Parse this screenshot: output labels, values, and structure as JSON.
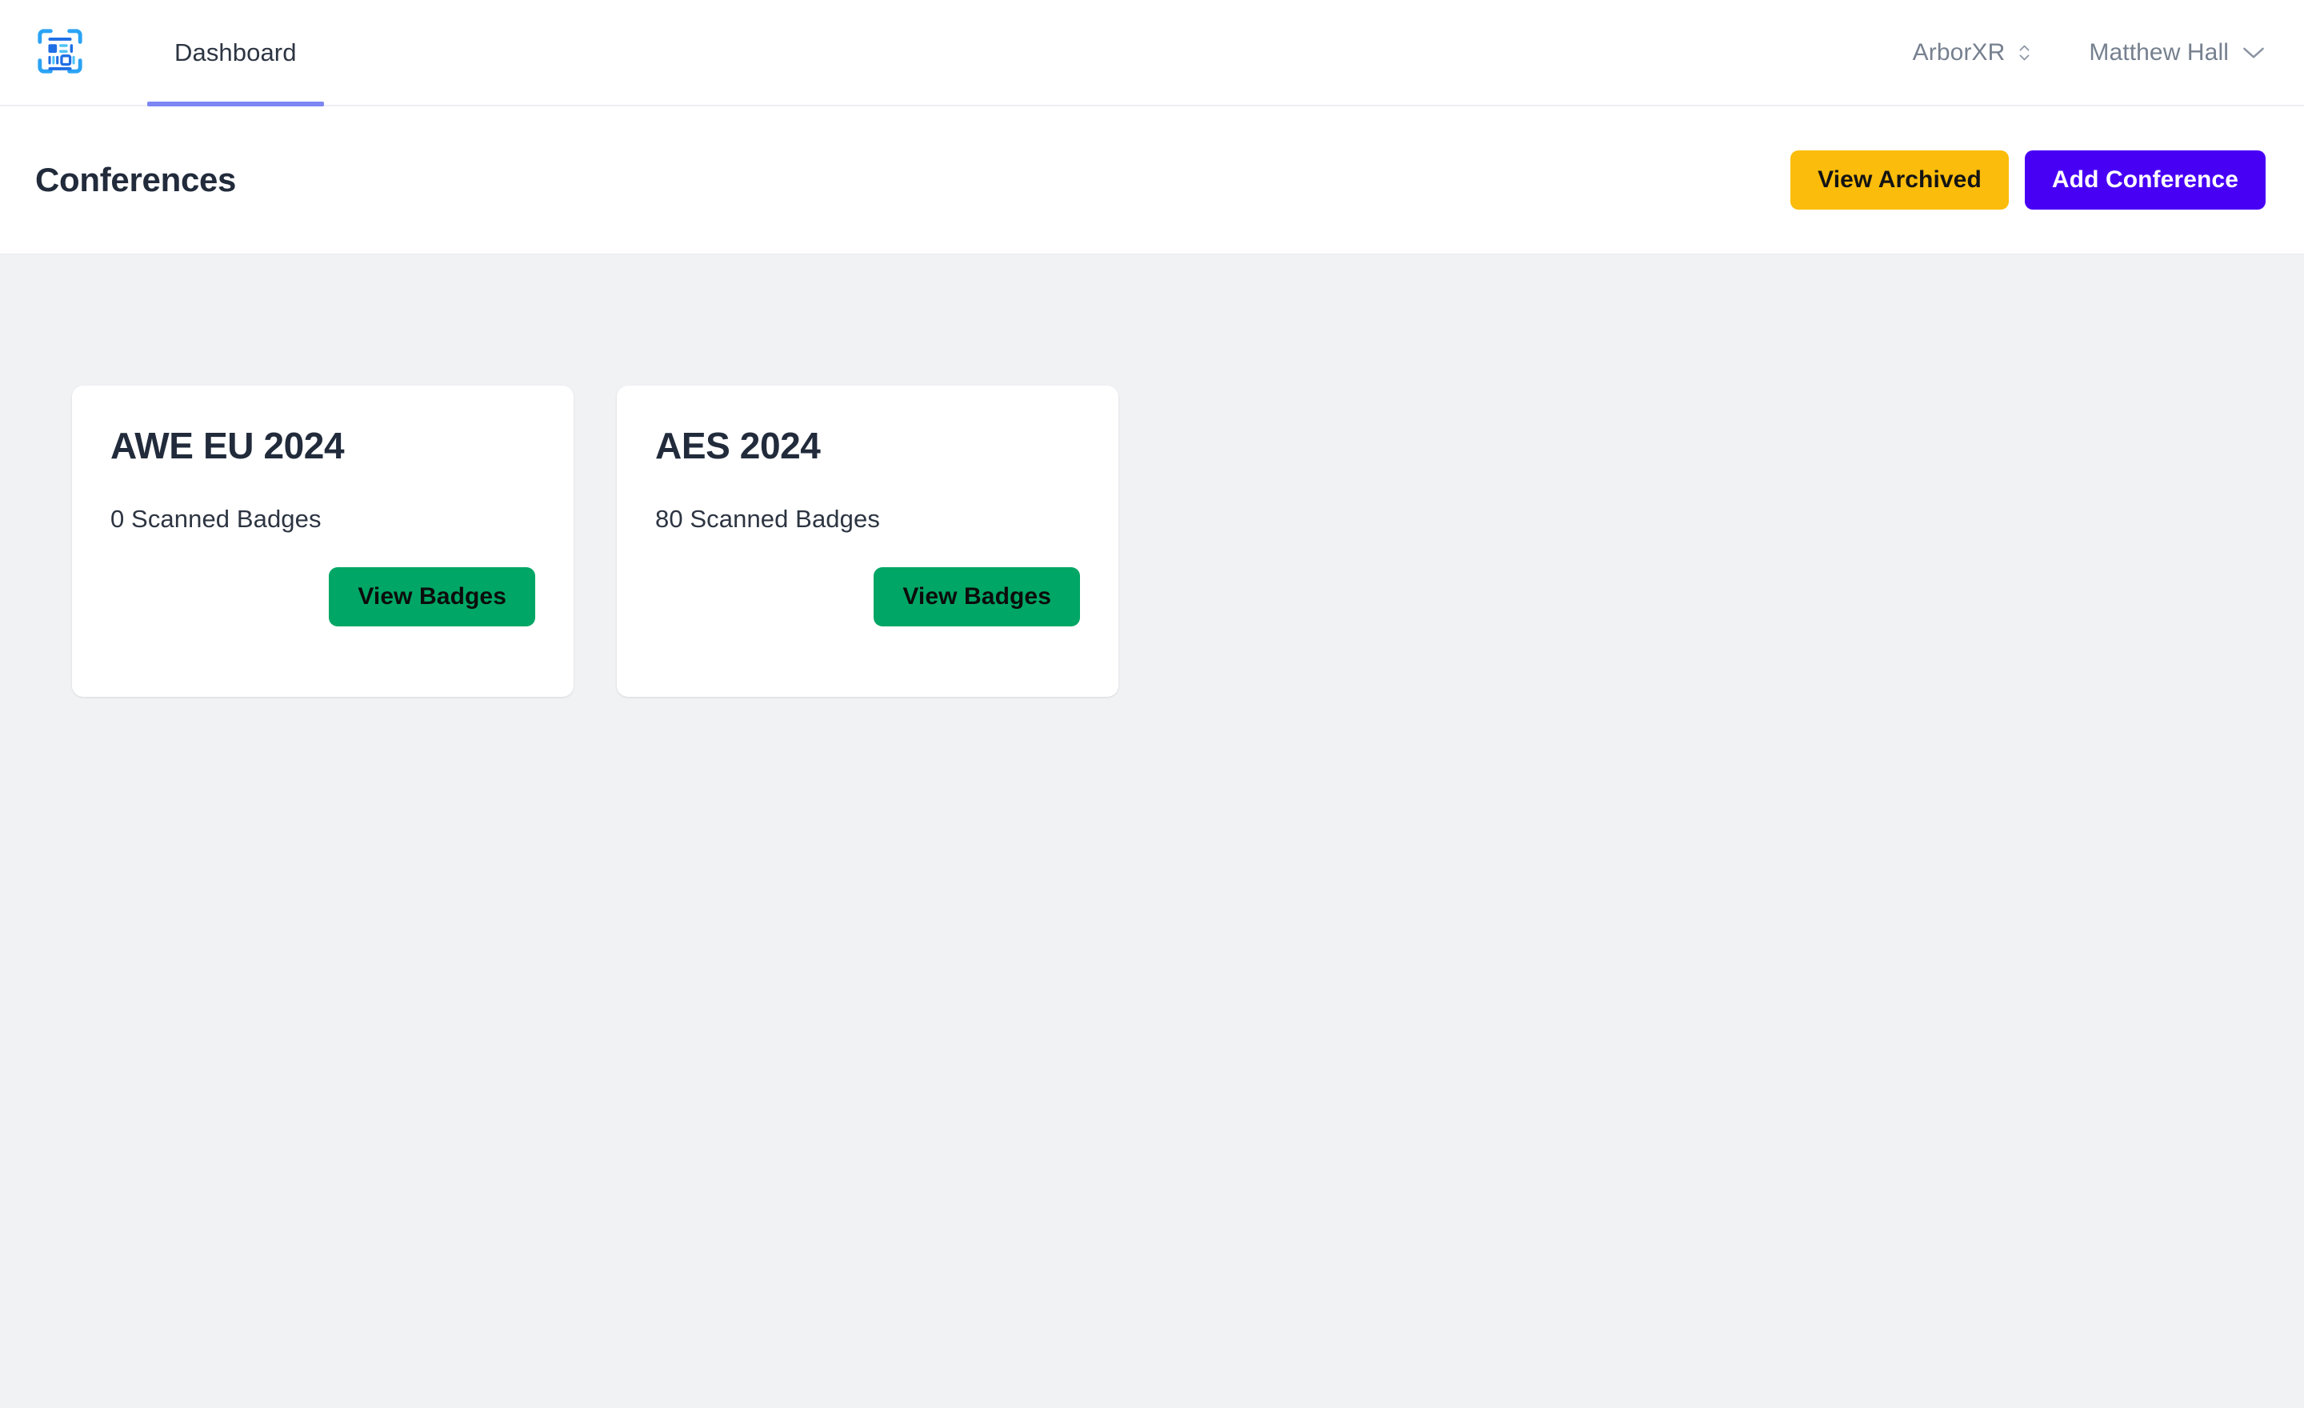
{
  "brand": {
    "logo_icon": "badge-scanner-icon",
    "logo_colors": {
      "bracket": "#2AA3F5",
      "dark_block": "#1F6FE5",
      "light_block": "#4FC3F7"
    }
  },
  "nav": {
    "tabs": [
      {
        "label": "Dashboard",
        "active": true
      }
    ],
    "org_switcher": {
      "label": "ArborXR",
      "icon": "chevron-up-down-icon"
    },
    "user_menu": {
      "label": "Matthew Hall",
      "icon": "chevron-down-icon"
    }
  },
  "page_header": {
    "title": "Conferences",
    "actions": [
      {
        "label": "View Archived",
        "name": "view-archived-button",
        "color": "#FBBC0B",
        "text_color": "#141414"
      },
      {
        "label": "Add Conference",
        "name": "add-conference-button",
        "color": "#4800F5",
        "text_color": "#FFFFFF"
      }
    ]
  },
  "conferences": [
    {
      "title": "AWE EU 2024",
      "scanned_badges": "0 Scanned Badges",
      "action_label": "View Badges"
    },
    {
      "title": "AES 2024",
      "scanned_badges": "80 Scanned Badges",
      "action_label": "View Badges"
    }
  ],
  "theme": {
    "accent_indigo": "#7C86F5",
    "primary_violet": "#4800F5",
    "amber": "#FBBC0B",
    "green": "#00A665",
    "page_bg": "#F1F2F4",
    "surface": "#FFFFFF",
    "text_dark": "#212B3B",
    "text_muted": "#76808F"
  }
}
